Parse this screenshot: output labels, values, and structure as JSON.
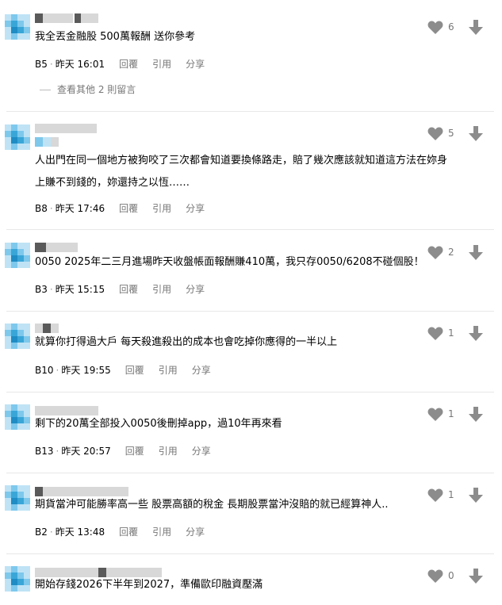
{
  "colors": {
    "avatar_light": "#bfe3f5",
    "avatar_mid": "#7ec8ec",
    "avatar_dark": "#3aa6d8",
    "avatar_accent": "#1f8cc4",
    "name_gray": "#d8d8d8",
    "name_dark": "#5a5a5a",
    "icon_gray": "#8c8c8c"
  },
  "icons": {
    "like": "heart-icon",
    "dislike": "arrow-down-icon"
  },
  "actions": {
    "reply": "回覆",
    "quote": "引用",
    "share": "分享"
  },
  "comments": [
    {
      "floor": "B5",
      "time": "昨天 16:01",
      "lines": [
        "我全丟金融股 500萬報酬 送你參考"
      ],
      "likes": "6",
      "more_replies": "查看其他 2 則留言"
    },
    {
      "floor": "B8",
      "time": "昨天 17:46",
      "lines": [
        "人出門在同一個地方被狗咬了三次都會知道要換條路走，賠了幾次應該就知道這方法在妳身",
        "上賺不到錢的，妳還持之以恆……"
      ],
      "likes": "5"
    },
    {
      "floor": "B3",
      "time": "昨天 15:15",
      "lines": [
        "0050 2025年二三月進場昨天收盤帳面報酬賺410萬，我只存0050/6208不碰個股！"
      ],
      "likes": "2"
    },
    {
      "floor": "B10",
      "time": "昨天 19:55",
      "lines": [
        "就算你打得過大戶 每天殺進殺出的成本也會吃掉你應得的一半以上"
      ],
      "likes": "1"
    },
    {
      "floor": "B13",
      "time": "昨天 20:57",
      "lines": [
        "剩下的20萬全部投入0050後刪掉app，過10年再來看"
      ],
      "likes": "1"
    },
    {
      "floor": "B2",
      "time": "昨天 13:48",
      "lines": [
        "期貨當沖可能勝率高一些 股票高額的稅金 長期股票當沖沒賠的就已經算神人.."
      ],
      "likes": "1"
    },
    {
      "floor": "",
      "time": "",
      "lines": [
        "開始存錢2026下半年到2027，準備歐印融資壓滿"
      ],
      "likes": "0"
    }
  ]
}
